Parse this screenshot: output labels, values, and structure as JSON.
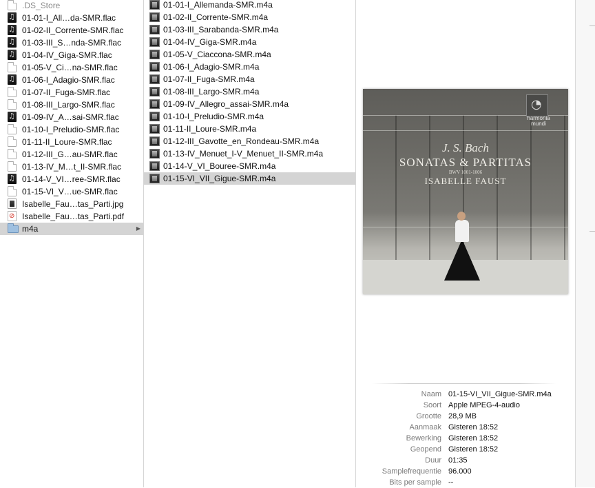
{
  "column1": {
    "items": [
      {
        "label": ".DS_Store",
        "icon": "document-icon",
        "dim": true
      },
      {
        "label": "01-01-I_All…da-SMR.flac",
        "icon": "audio-file-icon"
      },
      {
        "label": "01-02-II_Corrente-SMR.flac",
        "icon": "audio-file-icon"
      },
      {
        "label": "01-03-III_S…nda-SMR.flac",
        "icon": "audio-file-icon"
      },
      {
        "label": "01-04-IV_Giga-SMR.flac",
        "icon": "audio-file-icon"
      },
      {
        "label": "01-05-V_Ci…na-SMR.flac",
        "icon": "document-icon"
      },
      {
        "label": "01-06-I_Adagio-SMR.flac",
        "icon": "audio-file-icon"
      },
      {
        "label": "01-07-II_Fuga-SMR.flac",
        "icon": "document-icon"
      },
      {
        "label": "01-08-III_Largo-SMR.flac",
        "icon": "document-icon"
      },
      {
        "label": "01-09-IV_A…sai-SMR.flac",
        "icon": "audio-file-icon"
      },
      {
        "label": "01-10-I_Preludio-SMR.flac",
        "icon": "document-icon"
      },
      {
        "label": "01-11-II_Loure-SMR.flac",
        "icon": "document-icon"
      },
      {
        "label": "01-12-III_G…au-SMR.flac",
        "icon": "document-icon"
      },
      {
        "label": "01-13-IV_M…t_II-SMR.flac",
        "icon": "document-icon"
      },
      {
        "label": "01-14-V_VI…ree-SMR.flac",
        "icon": "audio-file-icon"
      },
      {
        "label": "01-15-VI_V…ue-SMR.flac",
        "icon": "document-icon"
      },
      {
        "label": "Isabelle_Fau…tas_Parti.jpg",
        "icon": "image-file-icon"
      },
      {
        "label": "Isabelle_Fau…tas_Parti.pdf",
        "icon": "pdf-file-icon"
      },
      {
        "label": "m4a",
        "icon": "folder-icon",
        "selected": true,
        "has_arrow": true
      }
    ],
    "arrow": "▶"
  },
  "column2": {
    "items": [
      {
        "label": "01-01-I_Allemanda-SMR.m4a"
      },
      {
        "label": "01-02-II_Corrente-SMR.m4a"
      },
      {
        "label": "01-03-III_Sarabanda-SMR.m4a"
      },
      {
        "label": "01-04-IV_Giga-SMR.m4a"
      },
      {
        "label": "01-05-V_Ciaccona-SMR.m4a"
      },
      {
        "label": "01-06-I_Adagio-SMR.m4a"
      },
      {
        "label": "01-07-II_Fuga-SMR.m4a"
      },
      {
        "label": "01-08-III_Largo-SMR.m4a"
      },
      {
        "label": "01-09-IV_Allegro_assai-SMR.m4a"
      },
      {
        "label": "01-10-I_Preludio-SMR.m4a"
      },
      {
        "label": "01-11-II_Loure-SMR.m4a"
      },
      {
        "label": "01-12-III_Gavotte_en_Rondeau-SMR.m4a"
      },
      {
        "label": "01-13-IV_Menuet_I-V_Menuet_II-SMR.m4a"
      },
      {
        "label": "01-14-V_VI_Bouree-SMR.m4a"
      },
      {
        "label": "01-15-VI_VII_Gigue-SMR.m4a",
        "selected": true
      }
    ],
    "icon": "m4a-file-icon"
  },
  "cover": {
    "composer": "J. S. Bach",
    "work": "SONATAS & PARTITAS",
    "catalog": "BWV 1001-1006",
    "performer": "ISABELLE FAUST",
    "label_line1": "harmonia",
    "label_line2": "mundi"
  },
  "info": [
    {
      "key": "Naam",
      "value": "01-15-VI_VII_Gigue-SMR.m4a"
    },
    {
      "key": "Soort",
      "value": "Apple MPEG-4-audio"
    },
    {
      "key": "Grootte",
      "value": "28,9 MB"
    },
    {
      "key": "Aanmaak",
      "value": "Gisteren 18:52"
    },
    {
      "key": "Bewerking",
      "value": "Gisteren 18:52"
    },
    {
      "key": "Geopend",
      "value": "Gisteren 18:52"
    },
    {
      "key": "Duur",
      "value": "01:35"
    },
    {
      "key": "Samplefrequentie",
      "value": "96.000"
    },
    {
      "key": "Bits per sample",
      "value": "--"
    }
  ]
}
